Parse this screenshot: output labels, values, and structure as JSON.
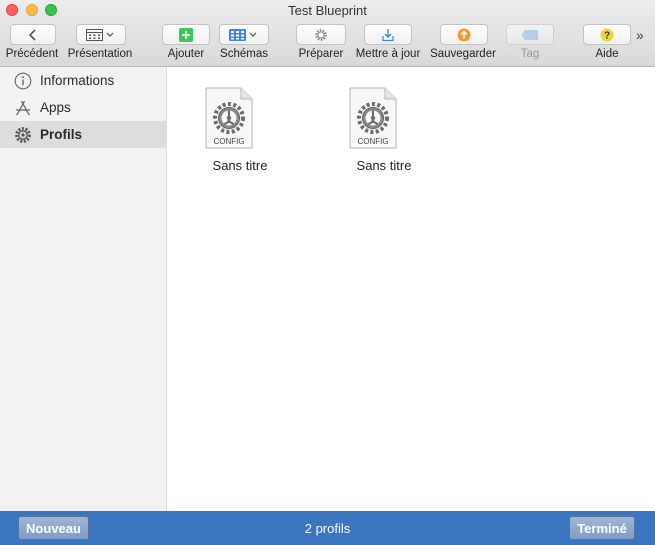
{
  "window": {
    "title": "Test Blueprint"
  },
  "toolbar": {
    "items": [
      {
        "label": "Précédent",
        "icon": "chevron-left-icon"
      },
      {
        "label": "Présentation",
        "icon": "view-options-icon"
      },
      {
        "label": "Ajouter",
        "icon": "plus-icon",
        "accent": "#3fc45a"
      },
      {
        "label": "Schémas",
        "icon": "grid-icon",
        "accent": "#3d86e3"
      },
      {
        "label": "Préparer",
        "icon": "gear-icon"
      },
      {
        "label": "Mettre à jour",
        "icon": "download-icon",
        "accent": "#3d86e3"
      },
      {
        "label": "Sauvegarder",
        "icon": "upload-circle-icon",
        "accent": "#f29b33"
      },
      {
        "label": "Tag",
        "icon": "tag-icon",
        "accent": "#8ec0f2",
        "disabled": true
      },
      {
        "label": "Aide",
        "icon": "question-icon",
        "accent": "#f4d23a"
      }
    ],
    "overflow": "»"
  },
  "sidebar": {
    "items": [
      {
        "label": "Informations",
        "icon": "info-icon",
        "selected": false
      },
      {
        "label": "Apps",
        "icon": "app-store-icon",
        "selected": false
      },
      {
        "label": "Profils",
        "icon": "gear-icon",
        "selected": true
      }
    ]
  },
  "main": {
    "files": [
      {
        "name": "Sans titre",
        "badge": "CONFIG"
      },
      {
        "name": "Sans titre",
        "badge": "CONFIG"
      }
    ]
  },
  "bottom_bar": {
    "new_label": "Nouveau",
    "status": "2 profils",
    "done_label": "Terminé",
    "color": "#3b74bf"
  }
}
